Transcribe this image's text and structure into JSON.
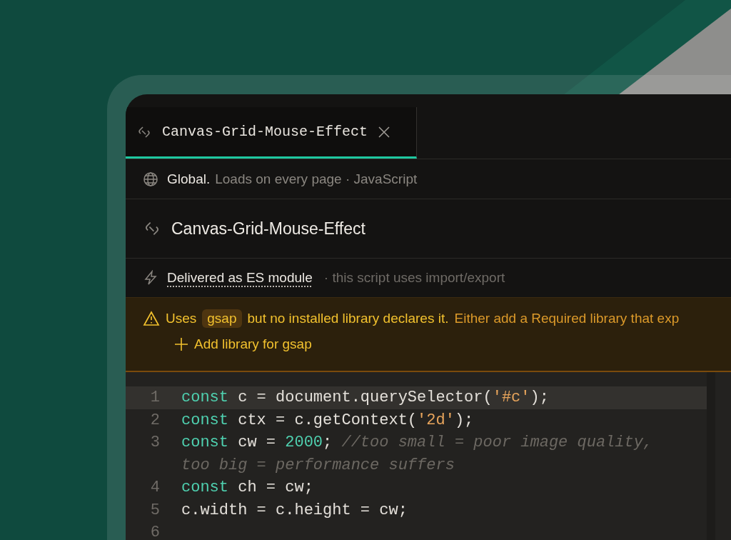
{
  "tab": {
    "label": "Canvas-Grid-Mouse-Effect",
    "selected": true
  },
  "scope": {
    "label": "Global.",
    "detail": "Loads on every page · JavaScript"
  },
  "script": {
    "title": "Canvas-Grid-Mouse-Effect"
  },
  "module": {
    "label": "Delivered as ES module",
    "note": "· this script uses import/export"
  },
  "warning": {
    "segments": [
      {
        "kind": "text",
        "text": "Uses"
      },
      {
        "kind": "code",
        "text": "gsap"
      },
      {
        "kind": "text",
        "text": "but no installed library declares it."
      },
      {
        "kind": "hint",
        "text": "Either add a Required library that exp"
      }
    ],
    "action": "Add library for gsap"
  },
  "code": [
    {
      "number": "1",
      "current": true,
      "tokens": [
        {
          "kind": "keyword",
          "text": "const"
        },
        {
          "kind": "plain",
          "text": " c = document.querySelector("
        },
        {
          "kind": "string",
          "text": "'#c'"
        },
        {
          "kind": "plain",
          "text": ");"
        }
      ]
    },
    {
      "number": "2",
      "current": false,
      "tokens": [
        {
          "kind": "keyword",
          "text": "const"
        },
        {
          "kind": "plain",
          "text": " ctx = c.getContext("
        },
        {
          "kind": "string",
          "text": "'2d'"
        },
        {
          "kind": "plain",
          "text": ");"
        }
      ]
    },
    {
      "number": "3",
      "current": false,
      "tokens": [
        {
          "kind": "keyword",
          "text": "const"
        },
        {
          "kind": "plain",
          "text": " cw = "
        },
        {
          "kind": "number",
          "text": "2000"
        },
        {
          "kind": "plain",
          "text": "; "
        },
        {
          "kind": "comment",
          "text": "//too small = poor image quality, too big = performance suffers"
        }
      ]
    },
    {
      "number": "4",
      "current": false,
      "tokens": [
        {
          "kind": "keyword",
          "text": "const"
        },
        {
          "kind": "plain",
          "text": " ch = cw;"
        }
      ]
    },
    {
      "number": "5",
      "current": false,
      "tokens": [
        {
          "kind": "plain",
          "text": "c.width = c.height = cw;"
        }
      ]
    },
    {
      "number": "6",
      "current": false
    }
  ]
}
